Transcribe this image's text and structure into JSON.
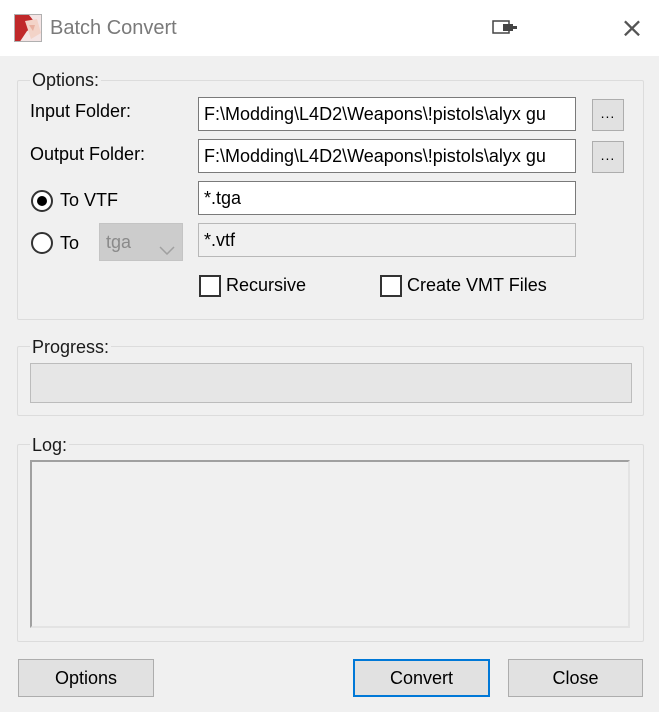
{
  "window": {
    "title": "Batch Convert"
  },
  "options": {
    "group_label": "Options:",
    "input_folder_label": "Input Folder:",
    "input_folder_value": "F:\\Modding\\L4D2\\Weapons\\!pistols\\alyx gu",
    "output_folder_label": "Output Folder:",
    "output_folder_value": "F:\\Modding\\L4D2\\Weapons\\!pistols\\alyx gu",
    "browse_label": "...",
    "to_vtf_label": "To VTF",
    "to_vtf_selected": true,
    "to_vtf_filter": "*.tga",
    "to_label": "To",
    "to_format": "tga",
    "to_filter": "*.vtf",
    "recursive_label": "Recursive",
    "recursive_checked": false,
    "create_vmt_label": "Create VMT Files",
    "create_vmt_checked": false
  },
  "progress": {
    "label": "Progress:",
    "value": 0
  },
  "log": {
    "label": "Log:"
  },
  "buttons": {
    "options": "Options",
    "convert": "Convert",
    "close": "Close"
  }
}
